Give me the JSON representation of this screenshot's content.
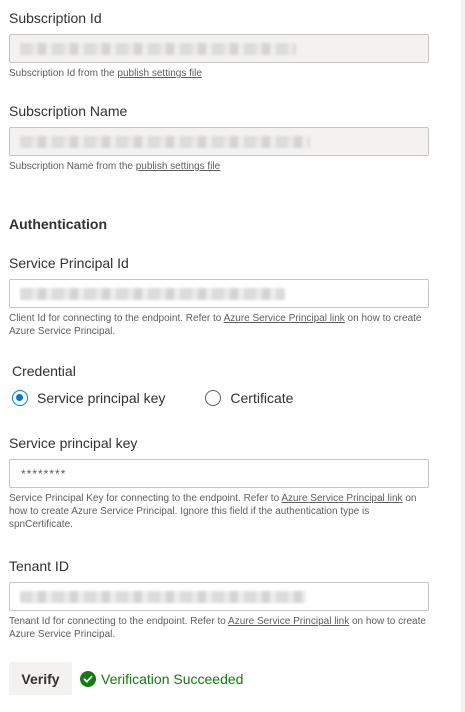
{
  "subscription_id": {
    "label": "Subscription Id",
    "help_prefix": "Subscription Id from the ",
    "help_link": "publish settings file"
  },
  "subscription_name": {
    "label": "Subscription Name",
    "help_prefix": "Subscription Name from the ",
    "help_link": "publish settings file"
  },
  "authentication": {
    "title": "Authentication"
  },
  "service_principal_id": {
    "label": "Service Principal Id",
    "help_prefix": "Client Id for connecting to the endpoint. Refer to ",
    "help_link": "Azure Service Principal link",
    "help_suffix": " on how to create Azure Service Principal."
  },
  "credential": {
    "label": "Credential",
    "options": [
      {
        "label": "Service principal key",
        "selected": true
      },
      {
        "label": "Certificate",
        "selected": false
      }
    ]
  },
  "service_principal_key": {
    "label": "Service principal key",
    "value": "********",
    "help_prefix": "Service Principal Key for connecting to the endpoint. Refer to ",
    "help_link": "Azure Service Principal link",
    "help_suffix": " on how to create Azure Service Principal. Ignore this field if the authentication type is spnCertificate."
  },
  "tenant_id": {
    "label": "Tenant ID",
    "help_prefix": "Tenant Id for connecting to the endpoint. Refer to ",
    "help_link": "Azure Service Principal link",
    "help_suffix": " on how to create Azure Service Principal."
  },
  "verify": {
    "button_label": "Verify",
    "status_text": "Verification Succeeded",
    "status_color": "#107c10"
  },
  "icons": {
    "status": "checkmark-circle-icon"
  },
  "colors": {
    "accent": "#0078d4",
    "success": "#107c10",
    "readonly_background": "#f3f2f1"
  }
}
